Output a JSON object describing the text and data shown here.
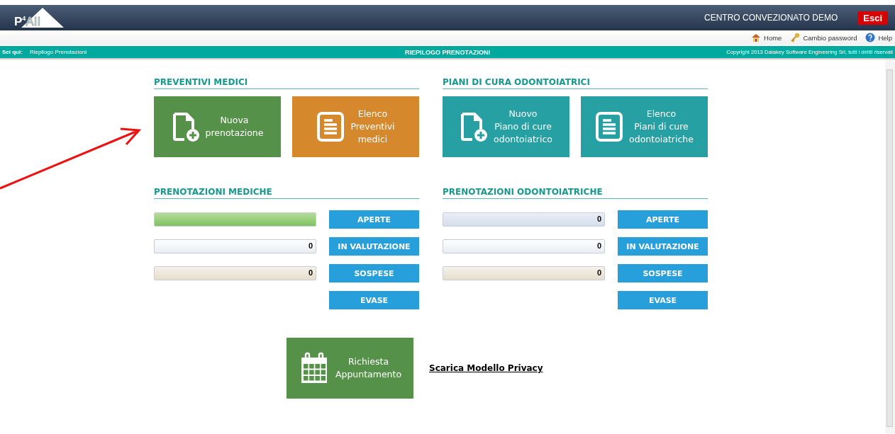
{
  "header": {
    "logo": {
      "letter": "P",
      "sup": "4",
      "word": "AII"
    },
    "center_name": "CENTRO CONVEZIONATO DEMO",
    "logout": "Esci"
  },
  "toolbar": [
    {
      "kind": "home",
      "label": "Home"
    },
    {
      "kind": "key",
      "label": "Cambio password"
    },
    {
      "kind": "help",
      "label": "Help"
    }
  ],
  "breadcrumb_bar": {
    "label": "Sei qui:",
    "path": "Riepilogo Prenotazioni",
    "title": "RIEPILOGO PRENOTAZIONI",
    "copyright": "Copyright 2013 Datakey Software Engineering Srl, tutti i diritti riservati"
  },
  "tile_sections": [
    {
      "title": "PREVENTIVI MEDICI",
      "tiles": [
        {
          "kind": "new",
          "color": "#56914a",
          "lines": [
            "Nuova",
            "prenotazione"
          ]
        },
        {
          "kind": "list",
          "color": "#d6882c",
          "lines": [
            "Elenco",
            "Preventivi",
            "medici"
          ]
        }
      ]
    },
    {
      "title": "PIANI DI CURA ODONTOIATRICI",
      "tiles": [
        {
          "kind": "new",
          "color": "#26a0a3",
          "lines": [
            "Nuovo",
            "Piano di cure",
            "odontoiatrico"
          ]
        },
        {
          "kind": "list",
          "color": "#26a0a3",
          "lines": [
            "Elenco",
            "Piani di cure",
            "odontoiatriche"
          ]
        }
      ]
    }
  ],
  "status_sections": [
    {
      "title": "PRENOTAZIONI MEDICHE",
      "rows": [
        {
          "kind": "green",
          "button": "APERTE"
        },
        {
          "kind": "white",
          "value": "0",
          "button": "IN VALUTAZIONE"
        },
        {
          "kind": "beige",
          "value": "0",
          "button": "SOSPESE"
        },
        {
          "kind": "none",
          "button": "EVASE"
        }
      ]
    },
    {
      "title": "PRENOTAZIONI ODONTOIATRICHE",
      "rows": [
        {
          "kind": "blue",
          "value": "0",
          "button": "APERTE"
        },
        {
          "kind": "white",
          "value": "0",
          "button": "IN VALUTAZIONE"
        },
        {
          "kind": "beige",
          "value": "0",
          "button": "SOSPESE"
        },
        {
          "kind": "none",
          "button": "EVASE"
        }
      ]
    }
  ],
  "appointment_tile": {
    "kind": "calendar",
    "color": "#56914a",
    "lines": [
      "Richiesta",
      "Appuntamento"
    ]
  },
  "privacy_link": "Scarica Modello Privacy",
  "annotation": {
    "kind": "arrow"
  }
}
